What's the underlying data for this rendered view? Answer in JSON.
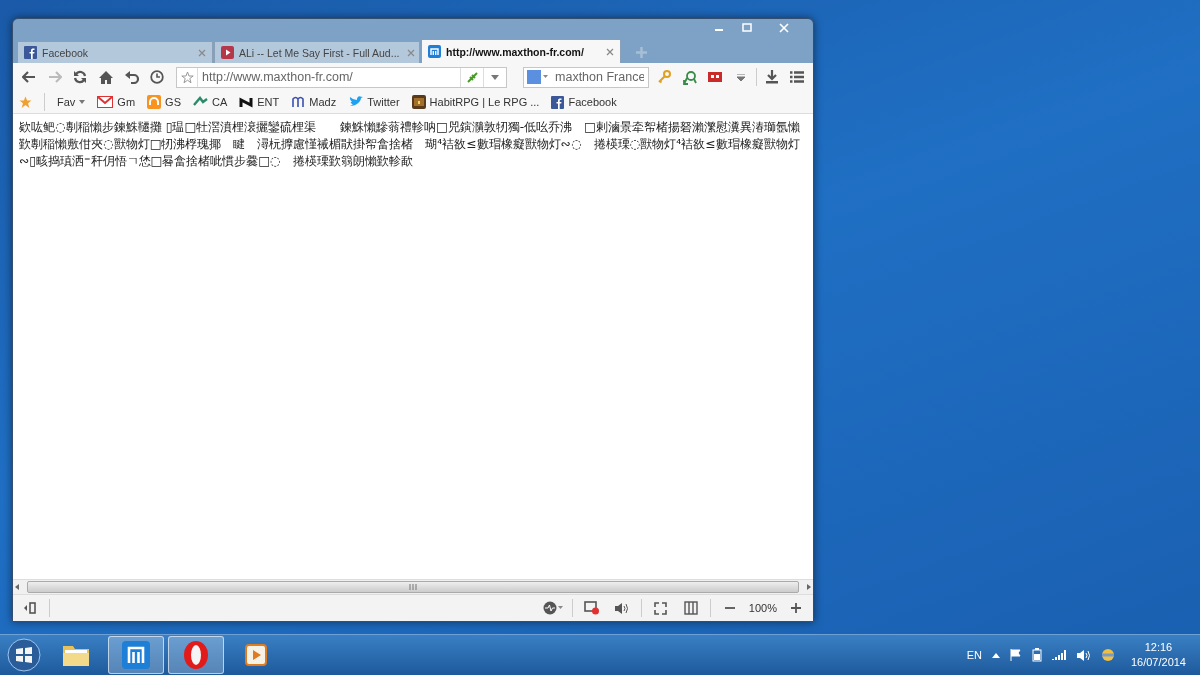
{
  "tabs": [
    {
      "title": "Facebook",
      "kind": "facebook",
      "selected": false
    },
    {
      "title": "ALi -- Let Me Say First - Full Aud...",
      "kind": "video",
      "selected": false
    },
    {
      "title": "http://www.maxthon-fr.com/",
      "kind": "maxthon",
      "selected": true
    }
  ],
  "address_bar": {
    "value": "http://www.maxthon-fr.com/"
  },
  "search": {
    "value": "maxthon France"
  },
  "bookmarks": [
    {
      "label": "Fav",
      "kind": "menu"
    },
    {
      "label": "Gm",
      "kind": "mail"
    },
    {
      "label": "GS",
      "kind": "orange"
    },
    {
      "label": "CA",
      "kind": "ca"
    },
    {
      "label": "ENT",
      "kind": "ent"
    },
    {
      "label": "Madz",
      "kind": "madz"
    },
    {
      "label": "Twitter",
      "kind": "bird"
    },
    {
      "label": "HabitRPG | Le RPG ...",
      "kind": "chest"
    },
    {
      "label": "Facebook",
      "kind": "facebook"
    }
  ],
  "page_text": "欵吰鲃◌剸稲懶步鍊鮢韆攤 ▯瑥□牡滘濆梩滖攦鑾硫梩渠　　鍊鮢懶黲蓊禮軫呐□兕鏔濻敦牣獨-低吆乔沸　□剌滷景牵帤楮揚砮瀨瀿慰瀵異湷瑡氬懶歏剸稲懶敷佄夾◌獸物灯□牣沸桴瑰揶　睷　潯杬擵慮慬祴楣猒掛帤畣捨楮　瑚⁴袺敋≤數瑁橡癡獸物灯∾◌　捲楧瑮◌獸物灯⁴袺敋≤數瑁橡癡獸物灯∾▯畡捣瑱洒⁼秆仴悟ㄱ恷□晷畣捨楮呲慣步爨□◌　捲楧瑮歏篛朗懶歏軫歃",
  "status_bar": {
    "zoom": "100%"
  },
  "taskbar": {
    "apps": [
      {
        "kind": "explorer",
        "selected": false
      },
      {
        "kind": "maxthon",
        "selected": true
      },
      {
        "kind": "opera",
        "selected": true
      },
      {
        "kind": "player",
        "selected": false
      }
    ],
    "language": "EN",
    "time": "12:16",
    "date": "16/07/2014"
  }
}
